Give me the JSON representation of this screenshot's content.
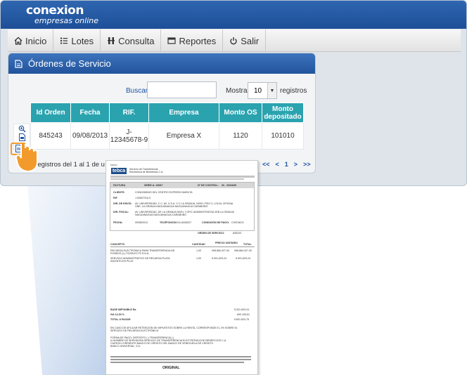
{
  "header": {
    "logo_name": "conexion",
    "logo_tagline": "empresas online",
    "brand_color": "#2f66b0"
  },
  "nav": {
    "items": [
      {
        "label": "Inicio",
        "icon": "home-icon"
      },
      {
        "label": "Lotes",
        "icon": "list-icon"
      },
      {
        "label": "Consulta",
        "icon": "people-icon"
      },
      {
        "label": "Reportes",
        "icon": "report-icon"
      },
      {
        "label": "Salir",
        "icon": "power-icon"
      }
    ]
  },
  "panel": {
    "title": "Órdenes de Servicio",
    "search_label": "Buscar:",
    "search_value": "",
    "show_label": "Mostrar",
    "page_size": "10",
    "records_label": "registros",
    "table": {
      "headers": [
        "Id Orden",
        "Fecha",
        "RIF.",
        "Empresa",
        "Monto OS",
        "Monto depositado"
      ],
      "rows": [
        {
          "id": "845243",
          "date": "09/08/2013",
          "rif": "J-12345678-9",
          "company": "Empresa X",
          "amount": "1120",
          "deposited": "101010"
        }
      ]
    },
    "info_text": "do registros del 1 al 1 de u",
    "pager": {
      "first": "<<",
      "prev": "<",
      "page": "1",
      "next": ">",
      "last": ">>"
    },
    "header_color": "#2aa3af",
    "highlight_color": "#f39a2c"
  },
  "invoice": {
    "brand_small": "banco",
    "brand": "tebca",
    "company_line": "Servicio de Transferencia",
    "company_line2": "Electrónica de Beneficios C.A.",
    "invoice_label": "FACTURA",
    "serie_label": "SERIE A: 2008?",
    "control_label": "Nº DE CONTROL:",
    "control_value": "00 - 0002835",
    "client_label": "CLIENTE:",
    "client_value": "CONDOMINIO DEL CENTRO EXPRESO BARUTA",
    "rif_label": "RIF",
    "rif_value": "J-00507310-0",
    "addr_label": "DIR. DE ENVÍO:",
    "addr_value": "AV. UNIVERSIDAD, C.C. AV. U.S.A. C.C LA GRANJA, NIVEL PISO 3, LOCAL OFICINA",
    "addr_value2": "ONE, LA GRANJA NAGUANAGUA NAGUANAGUA CARABOBO",
    "fiscal_label": "DIR. FISCAL:",
    "fiscal_value": "AV. UNIVERSIDAD, DE LA GRANJA NIVEL 3 OFIC ADMINISTRATIVA 2EB LA GRANJA",
    "fiscal_value2": "NAGUANAGUA NAGUANAGUA CARABOBO",
    "date_label": "FECHA:",
    "date_value": "09/08/2013",
    "phone_label": "TELÉFONOS:",
    "phone_value": "0241-8426327",
    "pay_label": "CONDICIÓN DE PAGO:",
    "pay_value": "CONTADO",
    "order_label": "ORDEN DE SERVICIO:",
    "order_value": "845243",
    "col_concept": "CONCEPTO",
    "col_qty": "CANTIDAD",
    "col_unit": "PRECIO UNITARIO",
    "col_total": "TOTAL",
    "line1": "RECARGA ELECTRÓNICA PARA TRANSFERENCIA DE",
    "line1b": "FONDOS (L) TICKELECTS S.N.A.",
    "line1_qty": "1,00",
    "line1_unit": "998.884.027,00",
    "line1_total": "998.884.027,00",
    "line2": "SERVICIO ADMINISTRATIVO DE RECARGA PLATA",
    "line2b": "INCENTIVOS PLUS",
    "line2_qty": "1,00",
    "line2_unit": "5.001.629,24",
    "line2_total": "5.001.629,24",
    "base_label": "BASE IMPONIBLE Bs",
    "base_value": "5.001.629,24",
    "iva_label": "IVA 12,00 %",
    "iva_value": "600.195,51",
    "total_label": "TOTAL A PAGAR",
    "total_value": "5.601.824,75",
    "note1": "EN CASO DE APLICAR RETENCIÓN DE IMPUESTOS SOBRE LA RENTA, CORRESPONDE EL 2% SOBRE EL",
    "note1b": "SERVICIO DE RECARGA ELECTRÓNICA",
    "note2": "FORMA DE PAGO: DEPÓSITO (  ) TRANSFERENCIA (  )",
    "note2b": "A NOMBRE DE SERVIDORA SERVICIO DE TRANSFERENCIA ELECTRÓNICA DE BENEFICIOS C.A.",
    "note2c": "CUENTA CORRIENTE BANCO DE CREDITO DEL BANCO DE VENEZUELA DE CREDITO",
    "note2d": "BANCO UNIVERSAL, S.A.",
    "original": "ORIGINAL"
  }
}
